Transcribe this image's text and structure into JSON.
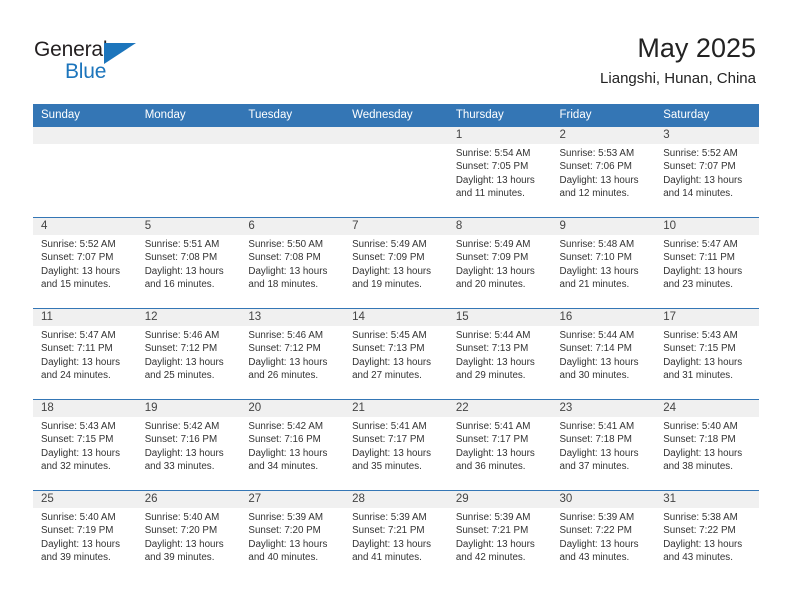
{
  "brand": {
    "name_primary": "General",
    "name_secondary": "Blue"
  },
  "header": {
    "title": "May 2025",
    "subtitle": "Liangshi, Hunan, China"
  },
  "colors": {
    "header_blue": "#3476b5",
    "logo_blue": "#1c75bc",
    "day_band_gray": "#f0f0f0"
  },
  "weekday_headers": [
    "Sunday",
    "Monday",
    "Tuesday",
    "Wednesday",
    "Thursday",
    "Friday",
    "Saturday"
  ],
  "weeks": [
    [
      {
        "day": "",
        "lines": []
      },
      {
        "day": "",
        "lines": []
      },
      {
        "day": "",
        "lines": []
      },
      {
        "day": "",
        "lines": []
      },
      {
        "day": "1",
        "lines": [
          "Sunrise: 5:54 AM",
          "Sunset: 7:05 PM",
          "Daylight: 13 hours",
          "and 11 minutes."
        ]
      },
      {
        "day": "2",
        "lines": [
          "Sunrise: 5:53 AM",
          "Sunset: 7:06 PM",
          "Daylight: 13 hours",
          "and 12 minutes."
        ]
      },
      {
        "day": "3",
        "lines": [
          "Sunrise: 5:52 AM",
          "Sunset: 7:07 PM",
          "Daylight: 13 hours",
          "and 14 minutes."
        ]
      }
    ],
    [
      {
        "day": "4",
        "lines": [
          "Sunrise: 5:52 AM",
          "Sunset: 7:07 PM",
          "Daylight: 13 hours",
          "and 15 minutes."
        ]
      },
      {
        "day": "5",
        "lines": [
          "Sunrise: 5:51 AM",
          "Sunset: 7:08 PM",
          "Daylight: 13 hours",
          "and 16 minutes."
        ]
      },
      {
        "day": "6",
        "lines": [
          "Sunrise: 5:50 AM",
          "Sunset: 7:08 PM",
          "Daylight: 13 hours",
          "and 18 minutes."
        ]
      },
      {
        "day": "7",
        "lines": [
          "Sunrise: 5:49 AM",
          "Sunset: 7:09 PM",
          "Daylight: 13 hours",
          "and 19 minutes."
        ]
      },
      {
        "day": "8",
        "lines": [
          "Sunrise: 5:49 AM",
          "Sunset: 7:09 PM",
          "Daylight: 13 hours",
          "and 20 minutes."
        ]
      },
      {
        "day": "9",
        "lines": [
          "Sunrise: 5:48 AM",
          "Sunset: 7:10 PM",
          "Daylight: 13 hours",
          "and 21 minutes."
        ]
      },
      {
        "day": "10",
        "lines": [
          "Sunrise: 5:47 AM",
          "Sunset: 7:11 PM",
          "Daylight: 13 hours",
          "and 23 minutes."
        ]
      }
    ],
    [
      {
        "day": "11",
        "lines": [
          "Sunrise: 5:47 AM",
          "Sunset: 7:11 PM",
          "Daylight: 13 hours",
          "and 24 minutes."
        ]
      },
      {
        "day": "12",
        "lines": [
          "Sunrise: 5:46 AM",
          "Sunset: 7:12 PM",
          "Daylight: 13 hours",
          "and 25 minutes."
        ]
      },
      {
        "day": "13",
        "lines": [
          "Sunrise: 5:46 AM",
          "Sunset: 7:12 PM",
          "Daylight: 13 hours",
          "and 26 minutes."
        ]
      },
      {
        "day": "14",
        "lines": [
          "Sunrise: 5:45 AM",
          "Sunset: 7:13 PM",
          "Daylight: 13 hours",
          "and 27 minutes."
        ]
      },
      {
        "day": "15",
        "lines": [
          "Sunrise: 5:44 AM",
          "Sunset: 7:13 PM",
          "Daylight: 13 hours",
          "and 29 minutes."
        ]
      },
      {
        "day": "16",
        "lines": [
          "Sunrise: 5:44 AM",
          "Sunset: 7:14 PM",
          "Daylight: 13 hours",
          "and 30 minutes."
        ]
      },
      {
        "day": "17",
        "lines": [
          "Sunrise: 5:43 AM",
          "Sunset: 7:15 PM",
          "Daylight: 13 hours",
          "and 31 minutes."
        ]
      }
    ],
    [
      {
        "day": "18",
        "lines": [
          "Sunrise: 5:43 AM",
          "Sunset: 7:15 PM",
          "Daylight: 13 hours",
          "and 32 minutes."
        ]
      },
      {
        "day": "19",
        "lines": [
          "Sunrise: 5:42 AM",
          "Sunset: 7:16 PM",
          "Daylight: 13 hours",
          "and 33 minutes."
        ]
      },
      {
        "day": "20",
        "lines": [
          "Sunrise: 5:42 AM",
          "Sunset: 7:16 PM",
          "Daylight: 13 hours",
          "and 34 minutes."
        ]
      },
      {
        "day": "21",
        "lines": [
          "Sunrise: 5:41 AM",
          "Sunset: 7:17 PM",
          "Daylight: 13 hours",
          "and 35 minutes."
        ]
      },
      {
        "day": "22",
        "lines": [
          "Sunrise: 5:41 AM",
          "Sunset: 7:17 PM",
          "Daylight: 13 hours",
          "and 36 minutes."
        ]
      },
      {
        "day": "23",
        "lines": [
          "Sunrise: 5:41 AM",
          "Sunset: 7:18 PM",
          "Daylight: 13 hours",
          "and 37 minutes."
        ]
      },
      {
        "day": "24",
        "lines": [
          "Sunrise: 5:40 AM",
          "Sunset: 7:18 PM",
          "Daylight: 13 hours",
          "and 38 minutes."
        ]
      }
    ],
    [
      {
        "day": "25",
        "lines": [
          "Sunrise: 5:40 AM",
          "Sunset: 7:19 PM",
          "Daylight: 13 hours",
          "and 39 minutes."
        ]
      },
      {
        "day": "26",
        "lines": [
          "Sunrise: 5:40 AM",
          "Sunset: 7:20 PM",
          "Daylight: 13 hours",
          "and 39 minutes."
        ]
      },
      {
        "day": "27",
        "lines": [
          "Sunrise: 5:39 AM",
          "Sunset: 7:20 PM",
          "Daylight: 13 hours",
          "and 40 minutes."
        ]
      },
      {
        "day": "28",
        "lines": [
          "Sunrise: 5:39 AM",
          "Sunset: 7:21 PM",
          "Daylight: 13 hours",
          "and 41 minutes."
        ]
      },
      {
        "day": "29",
        "lines": [
          "Sunrise: 5:39 AM",
          "Sunset: 7:21 PM",
          "Daylight: 13 hours",
          "and 42 minutes."
        ]
      },
      {
        "day": "30",
        "lines": [
          "Sunrise: 5:39 AM",
          "Sunset: 7:22 PM",
          "Daylight: 13 hours",
          "and 43 minutes."
        ]
      },
      {
        "day": "31",
        "lines": [
          "Sunrise: 5:38 AM",
          "Sunset: 7:22 PM",
          "Daylight: 13 hours",
          "and 43 minutes."
        ]
      }
    ]
  ]
}
